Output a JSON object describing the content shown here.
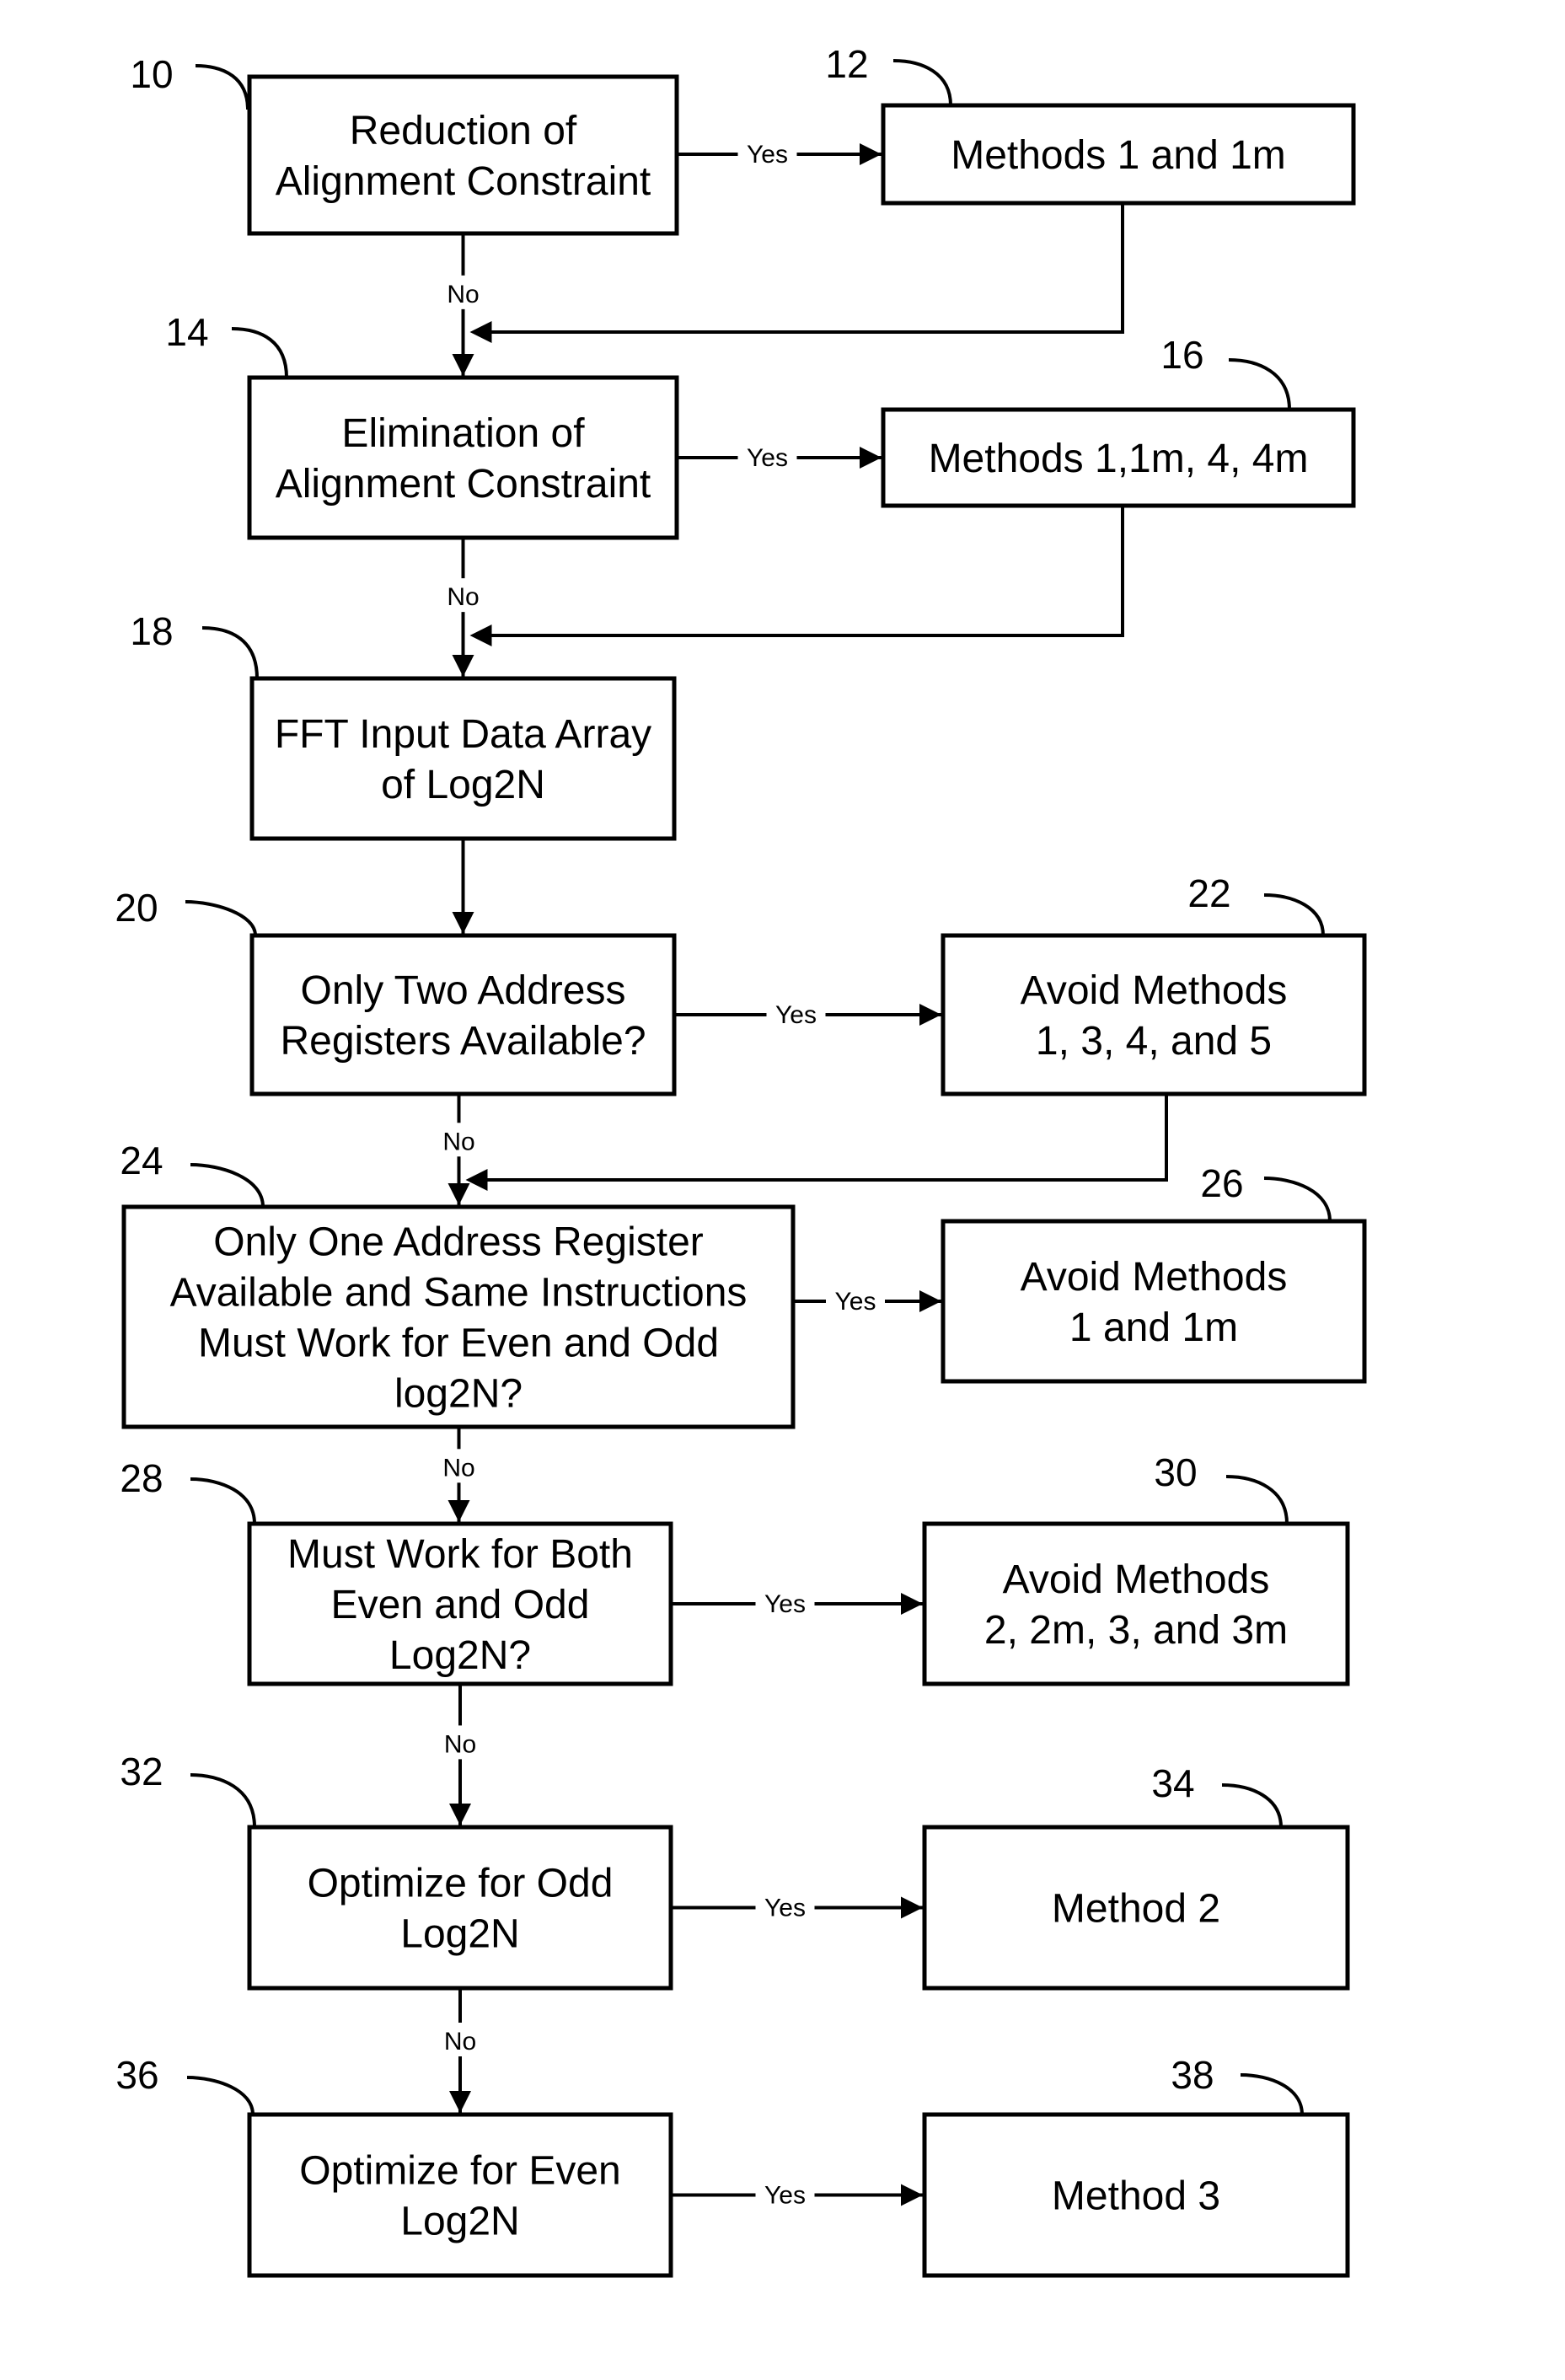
{
  "diagram": {
    "type": "flowchart",
    "nodes": [
      {
        "id": "10",
        "ref": "10",
        "lines": [
          "Reduction of",
          "Alignment Constraint"
        ]
      },
      {
        "id": "12",
        "ref": "12",
        "lines": [
          "Methods 1 and 1m"
        ]
      },
      {
        "id": "14",
        "ref": "14",
        "lines": [
          "Elimination of",
          "Alignment Constraint"
        ]
      },
      {
        "id": "16",
        "ref": "16",
        "lines": [
          "Methods 1,1m, 4, 4m"
        ]
      },
      {
        "id": "18",
        "ref": "18",
        "lines": [
          "FFT Input Data Array",
          "of Log2N"
        ]
      },
      {
        "id": "20",
        "ref": "20",
        "lines": [
          "Only Two Address",
          "Registers Available?"
        ]
      },
      {
        "id": "22",
        "ref": "22",
        "lines": [
          "Avoid Methods",
          "1, 3, 4, and 5"
        ]
      },
      {
        "id": "24",
        "ref": "24",
        "lines": [
          "Only One Address Register",
          "Available and Same Instructions",
          "Must Work for Even and Odd",
          "log2N?"
        ]
      },
      {
        "id": "26",
        "ref": "26",
        "lines": [
          "Avoid Methods",
          "1 and 1m"
        ]
      },
      {
        "id": "28",
        "ref": "28",
        "lines": [
          "Must Work for Both",
          "Even and Odd",
          "Log2N?"
        ]
      },
      {
        "id": "30",
        "ref": "30",
        "lines": [
          "Avoid Methods",
          "2, 2m, 3, and 3m"
        ]
      },
      {
        "id": "32",
        "ref": "32",
        "lines": [
          "Optimize for Odd",
          "Log2N"
        ]
      },
      {
        "id": "34",
        "ref": "34",
        "lines": [
          "Method 2"
        ]
      },
      {
        "id": "36",
        "ref": "36",
        "lines": [
          "Optimize for Even",
          "Log2N"
        ]
      },
      {
        "id": "38",
        "ref": "38",
        "lines": [
          "Method 3"
        ]
      }
    ],
    "edges": [
      {
        "from": "10",
        "to": "12",
        "label": "Yes"
      },
      {
        "from": "10",
        "to": "14",
        "label": "No"
      },
      {
        "from": "12",
        "to": "14",
        "label": ""
      },
      {
        "from": "14",
        "to": "16",
        "label": "Yes"
      },
      {
        "from": "14",
        "to": "18",
        "label": "No"
      },
      {
        "from": "16",
        "to": "18",
        "label": ""
      },
      {
        "from": "18",
        "to": "20",
        "label": ""
      },
      {
        "from": "20",
        "to": "22",
        "label": "Yes"
      },
      {
        "from": "20",
        "to": "24",
        "label": "No"
      },
      {
        "from": "22",
        "to": "24",
        "label": ""
      },
      {
        "from": "24",
        "to": "26",
        "label": "Yes"
      },
      {
        "from": "24",
        "to": "28",
        "label": "No"
      },
      {
        "from": "28",
        "to": "30",
        "label": "Yes"
      },
      {
        "from": "28",
        "to": "32",
        "label": "No"
      },
      {
        "from": "32",
        "to": "34",
        "label": "Yes"
      },
      {
        "from": "32",
        "to": "36",
        "label": "No"
      },
      {
        "from": "36",
        "to": "38",
        "label": "Yes"
      }
    ]
  }
}
